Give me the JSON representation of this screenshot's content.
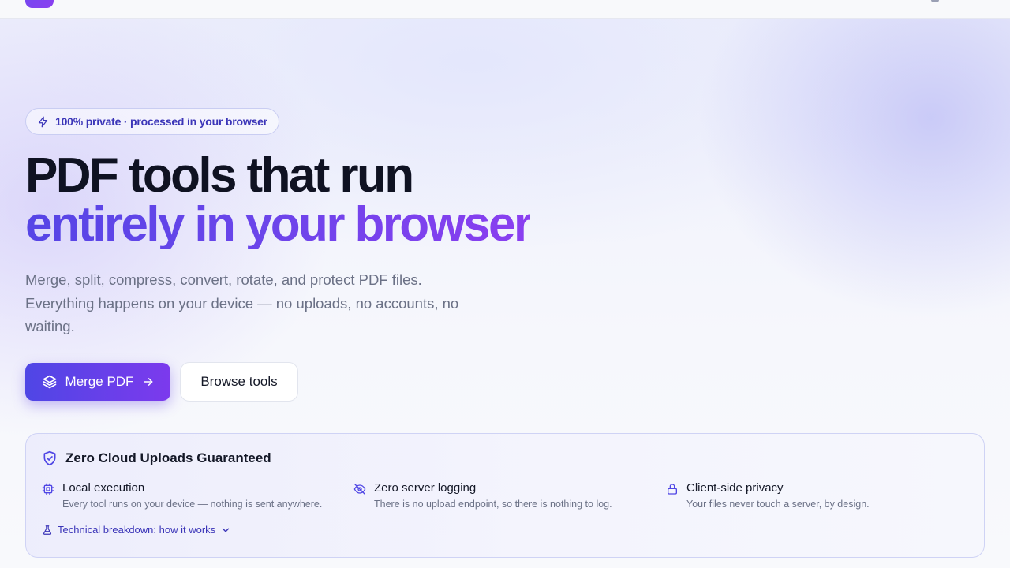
{
  "colors": {
    "accent": "#4f46e5",
    "accent_violet": "#7c3aed",
    "heading": "#0f1222",
    "muted": "#6b7186"
  },
  "badge": {
    "icon": "lightning-icon",
    "text": "100% private · processed in your browser"
  },
  "hero": {
    "title_line1": "PDF tools that run",
    "title_line2": "entirely in your browser",
    "lead": "Merge, split, compress, convert, rotate, and protect PDF files. Everything happens on your device — no uploads, no accounts, no waiting."
  },
  "actions": {
    "primary_label": "Merge PDF",
    "primary_icon": "layers-icon",
    "secondary_label": "Browse tools"
  },
  "guarantee": {
    "title": "Zero Cloud Uploads Guaranteed",
    "features": [
      {
        "icon": "cpu-icon",
        "title": "Local execution",
        "desc": "Every tool runs on your device — nothing is sent anywhere."
      },
      {
        "icon": "eye-off-icon",
        "title": "Zero server logging",
        "desc": "There is no upload endpoint, so there is nothing to log."
      },
      {
        "icon": "lock-icon",
        "title": "Client-side privacy",
        "desc": "Your files never touch a server, by design."
      }
    ],
    "breakdown_label": "Technical breakdown: how it works"
  }
}
